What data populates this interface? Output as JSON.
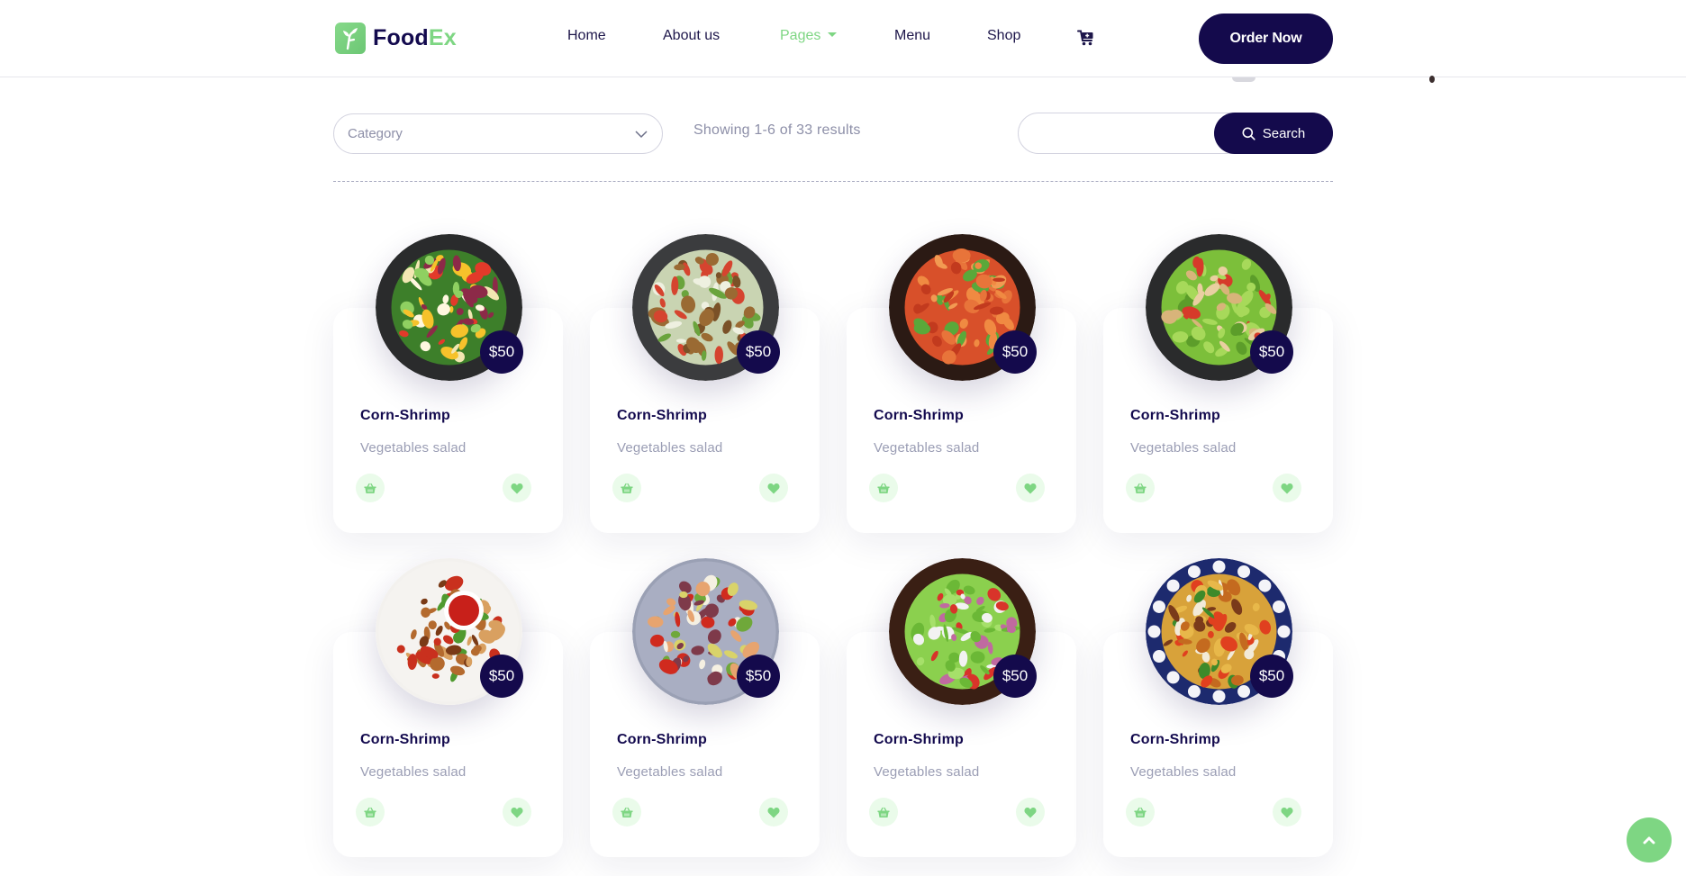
{
  "header": {
    "logo": {
      "part1": "Food",
      "part2": "Ex",
      "icon": "leaf-logo-icon"
    },
    "nav": [
      {
        "label": "Home",
        "active": false
      },
      {
        "label": "About us",
        "active": false
      },
      {
        "label": "Pages",
        "active": true,
        "has_dropdown": true
      },
      {
        "label": "Menu",
        "active": false
      },
      {
        "label": "Shop",
        "active": false
      }
    ],
    "cart_icon": "cart-plus-icon",
    "order_button": "Order Now"
  },
  "filters": {
    "category": {
      "selected": "Category",
      "icon": "chevron-down-icon"
    },
    "results_text": "Showing 1-6 of 33 results",
    "search": {
      "value": "",
      "placeholder": "",
      "button_label": "Search",
      "icon": "search-icon"
    }
  },
  "products": [
    {
      "title": "Corn-Shrimp",
      "subtitle": "Vegetables salad",
      "price": "$50",
      "dish": "egg-vegetable-salad"
    },
    {
      "title": "Corn-Shrimp",
      "subtitle": "Vegetables salad",
      "price": "$50",
      "dish": "crouton-salad"
    },
    {
      "title": "Corn-Shrimp",
      "subtitle": "Vegetables salad",
      "price": "$50",
      "dish": "spaghetti-tomato"
    },
    {
      "title": "Corn-Shrimp",
      "subtitle": "Vegetables salad",
      "price": "$50",
      "dish": "chicken-salad"
    },
    {
      "title": "Corn-Shrimp",
      "subtitle": "Vegetables salad",
      "price": "$50",
      "dish": "grilled-wings-sauce"
    },
    {
      "title": "Corn-Shrimp",
      "subtitle": "Vegetables salad",
      "price": "$50",
      "dish": "grilled-salmon"
    },
    {
      "title": "Corn-Shrimp",
      "subtitle": "Vegetables salad",
      "price": "$50",
      "dish": "green-tomato-salad"
    },
    {
      "title": "Corn-Shrimp",
      "subtitle": "Vegetables salad",
      "price": "$50",
      "dish": "pilaf"
    }
  ],
  "card_actions": {
    "basket_icon": "basket-icon",
    "heart_icon": "heart-icon"
  },
  "scroll_top": {
    "icon": "chevron-up-icon"
  },
  "colors": {
    "brand_dark": "#140a4c",
    "brand_green": "#7ed683",
    "green_soft": "#eafbea",
    "muted_text": "#8d8fa8"
  }
}
